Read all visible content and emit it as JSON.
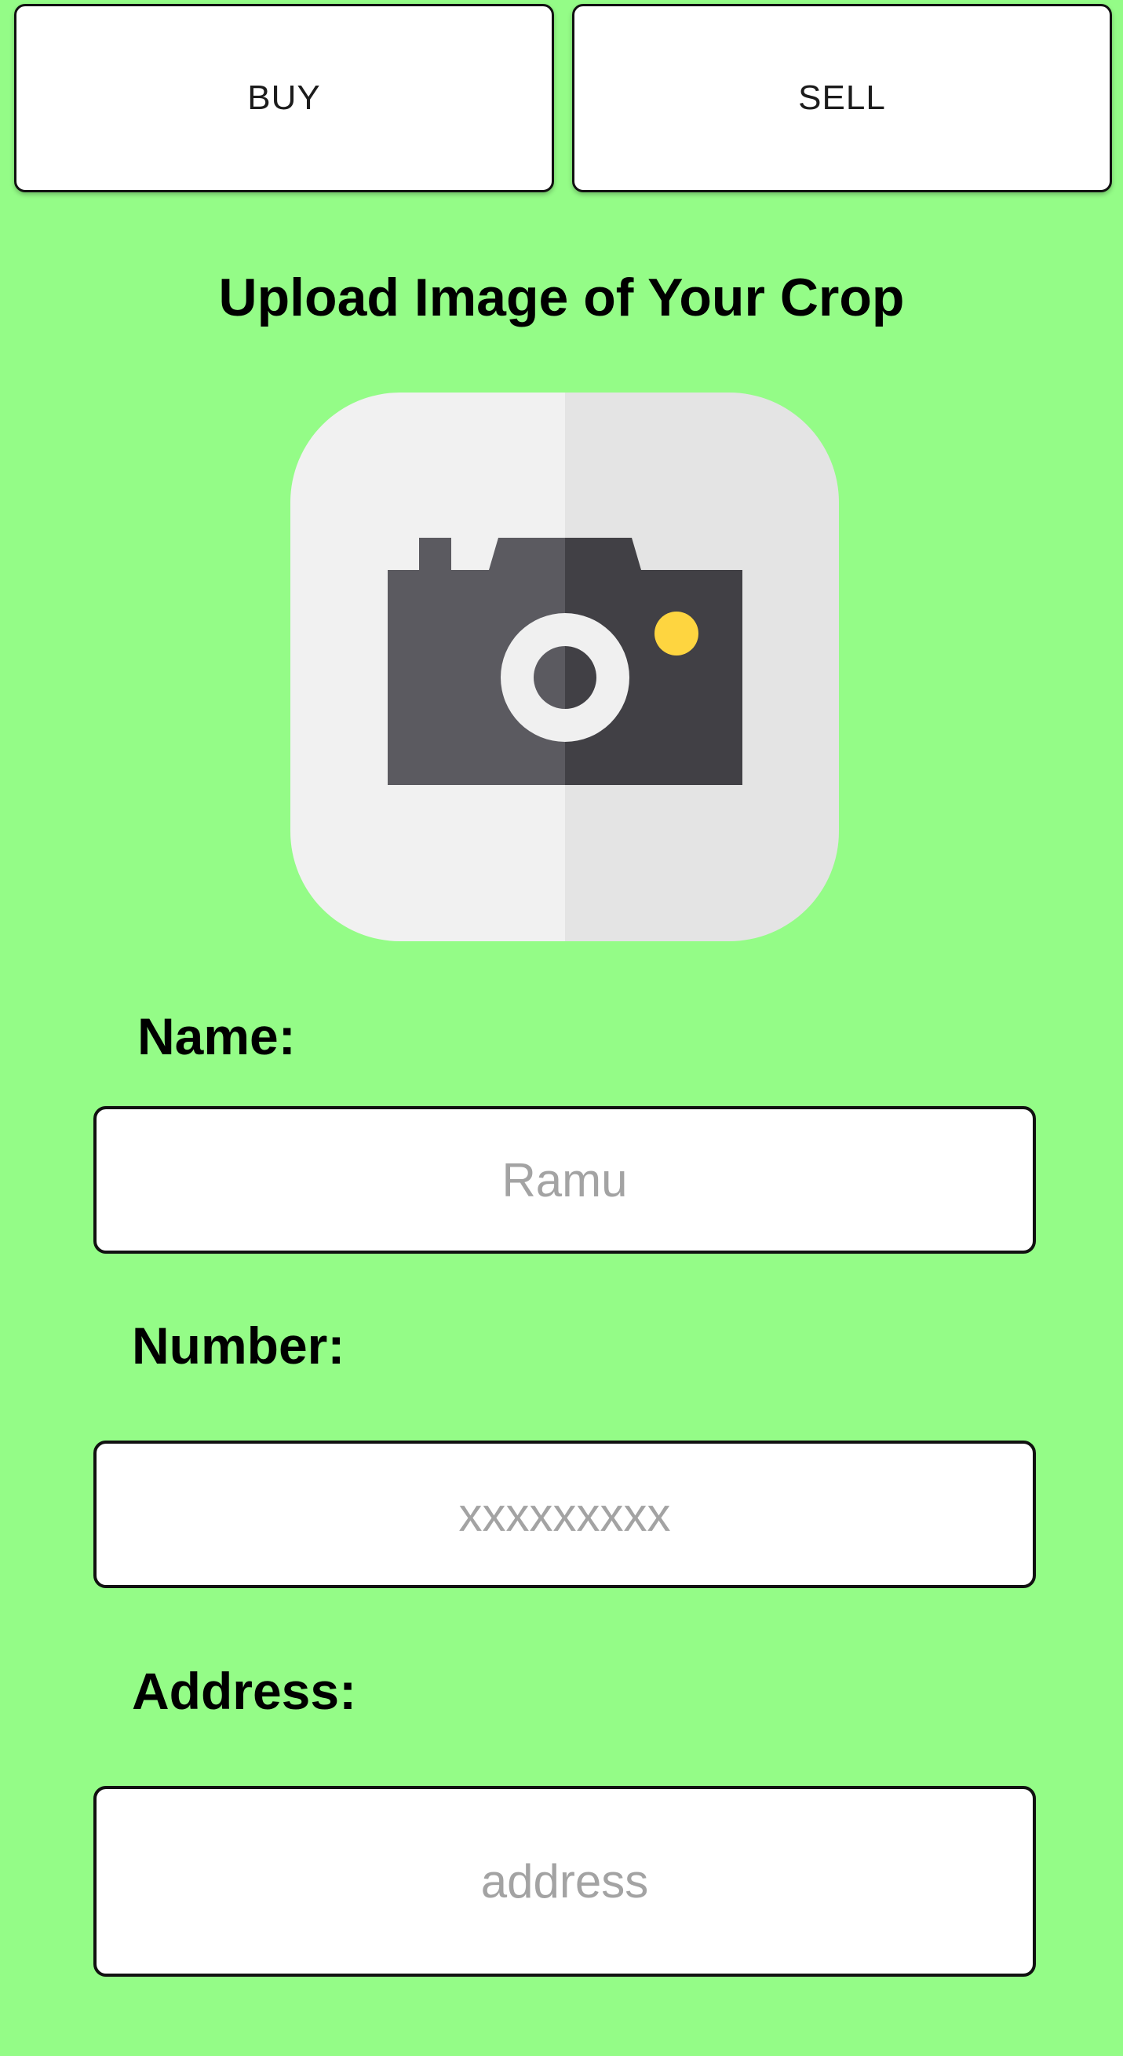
{
  "tabs": {
    "buy_label": "BUY",
    "sell_label": "SELL"
  },
  "upload": {
    "title": "Upload Image of Your Crop",
    "icon": "camera-icon"
  },
  "form": {
    "name": {
      "label": "Name:",
      "value": "",
      "placeholder": "Ramu"
    },
    "number": {
      "label": "Number:",
      "value": "",
      "placeholder": "xxxxxxxxx"
    },
    "address": {
      "label": "Address:",
      "value": "",
      "placeholder": "address"
    }
  },
  "colors": {
    "background": "#94fc87",
    "tile_light": "#f1f1f1",
    "tile_shade": "#e4e4e4",
    "camera_body": "#5b5a60",
    "camera_shade": "#414045",
    "lens_ring": "#f0f0f0",
    "flash": "#fed540"
  }
}
